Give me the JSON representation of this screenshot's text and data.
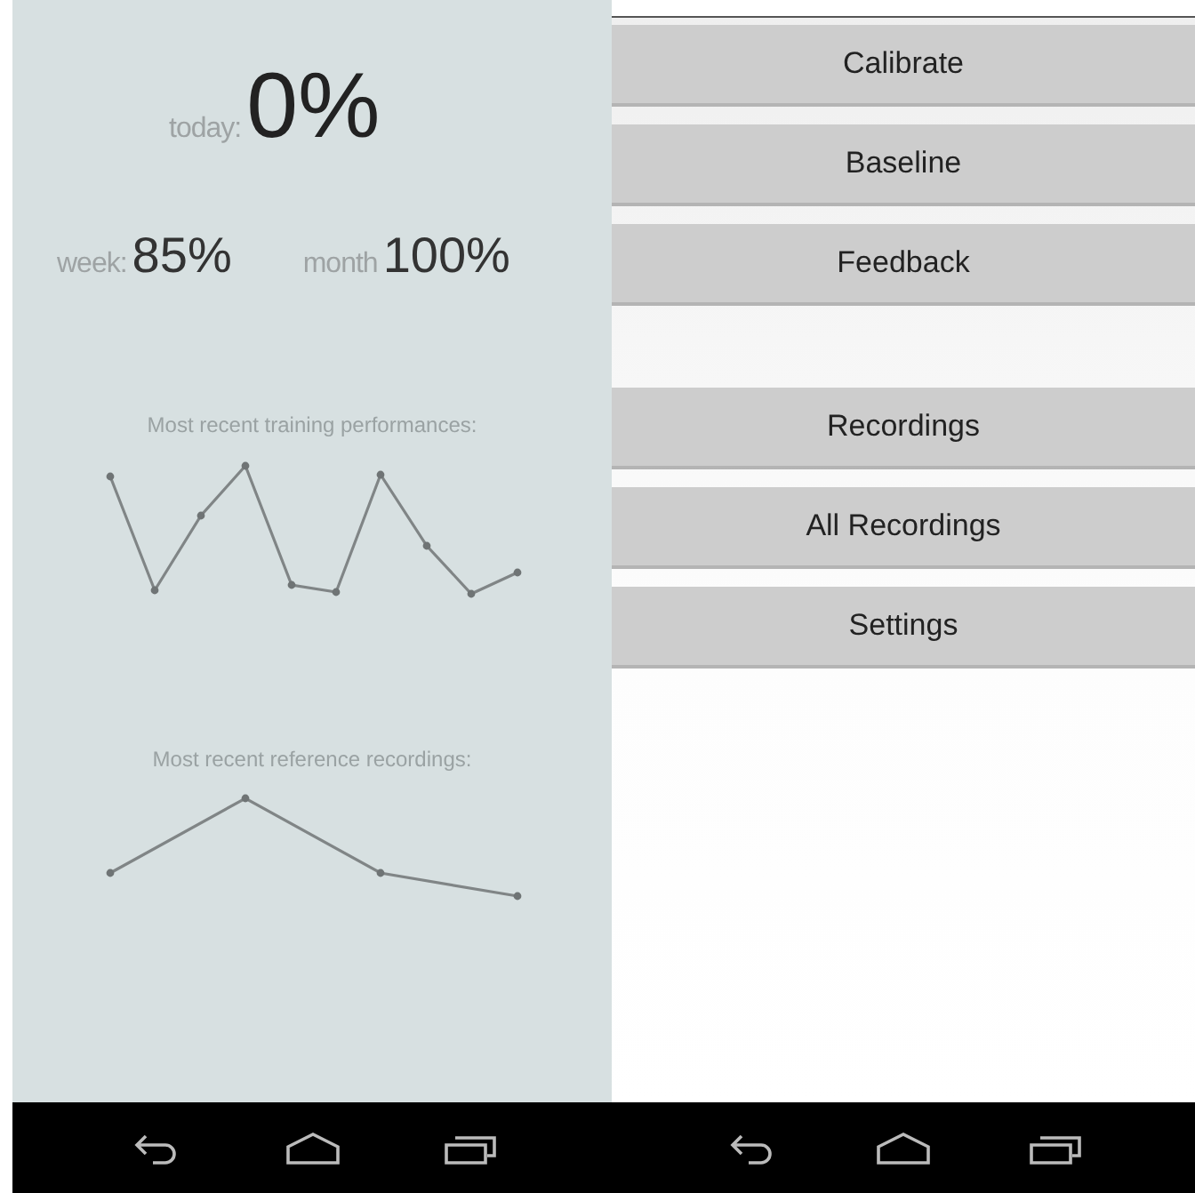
{
  "stats": {
    "today": {
      "label": "today:",
      "value": "0%"
    },
    "week": {
      "label": "week:",
      "value": "85%"
    },
    "month": {
      "label": "month",
      "value": "100%"
    }
  },
  "charts": [
    {
      "title": "Most recent training performances:"
    },
    {
      "title": "Most recent reference recordings:"
    }
  ],
  "menu_groups": [
    [
      "Calibrate",
      "Baseline",
      "Feedback"
    ],
    [
      "Recordings",
      "All Recordings",
      "Settings"
    ]
  ]
}
